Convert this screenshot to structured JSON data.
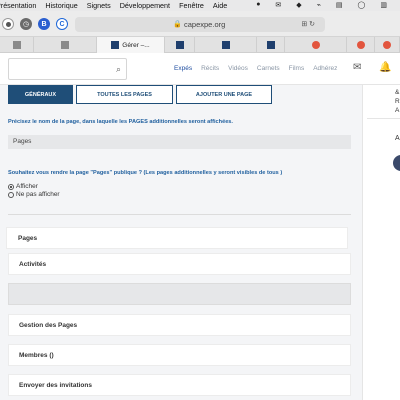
{
  "menubar": {
    "items": [
      "Présentation",
      "Historique",
      "Signets",
      "Développement",
      "Fenêtre",
      "Aide"
    ],
    "tray": [
      "●",
      "✉",
      "◆",
      "⌁",
      "▤",
      "◯",
      "▥"
    ]
  },
  "browser": {
    "url": "capexpe.org",
    "lock": "🔒",
    "reader": "⊞ ↻",
    "tabs": [
      {
        "icon": "gr",
        "label": ""
      },
      {
        "icon": "gr",
        "label": ""
      },
      {
        "icon": "fb",
        "label": "Gérer –..."
      },
      {
        "icon": "fb",
        "label": ""
      },
      {
        "icon": "fb",
        "label": ""
      },
      {
        "icon": "fb",
        "label": ""
      },
      {
        "icon": "re",
        "label": ""
      },
      {
        "icon": "re",
        "label": ""
      },
      {
        "icon": "re",
        "label": ""
      }
    ]
  },
  "header": {
    "search_placeholder": "",
    "nav": [
      "Expés",
      "Récits",
      "Vidéos",
      "Carnets",
      "Films",
      "Adhérez"
    ],
    "active_nav": "Expés",
    "icons": [
      "envelope-icon",
      "bell-icon"
    ]
  },
  "right_panel": {
    "lines": [
      "&",
      "Ré",
      "A"
    ],
    "a_label": "A"
  },
  "tabs": [
    {
      "label": "GÉNÉRAUX",
      "active": true
    },
    {
      "label": "TOUTES LES PAGES",
      "active": false
    },
    {
      "label": "AJOUTER UNE PAGE",
      "active": false
    }
  ],
  "form": {
    "name_label": "Précisez le nom de la page, dans laquelle les PAGES additionnelles seront affichées.",
    "name_value": "Pages",
    "public_label": "Souhaitez vous rendre la page \"Pages\" publique ? (Les pages additionnelles y seront visibles de tous )",
    "options": [
      {
        "label": "Afficher",
        "checked": true
      },
      {
        "label": "Ne pas afficher",
        "checked": false
      }
    ]
  },
  "sections": [
    "Pages",
    "Activités",
    "",
    "Gestion des Pages",
    "Membres ()",
    "Envoyer des invitations"
  ],
  "colors": {
    "accent": "#1f4e78",
    "label_blue": "#1f5f9e",
    "nav_active": "#1f4ea0"
  }
}
